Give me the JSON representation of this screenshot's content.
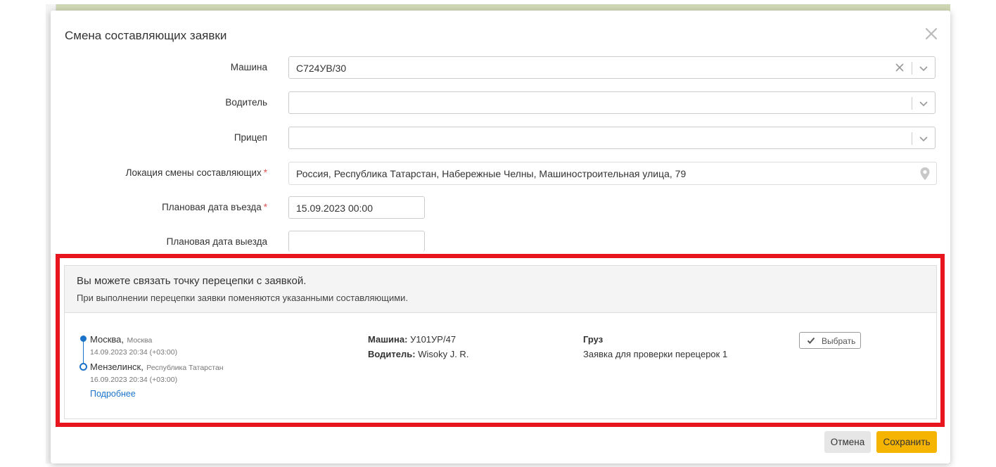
{
  "modal": {
    "title": "Смена составляющих заявки"
  },
  "form": {
    "vehicle_label": "Машина",
    "vehicle_value": "С724УВ/30",
    "driver_label": "Водитель",
    "driver_value": "",
    "trailer_label": "Прицеп",
    "trailer_value": "",
    "location_label": "Локация смены составляющих",
    "location_value": "Россия, Республика Татарстан, Набережные Челны, Машиностроительная улица, 79",
    "entry_date_label": "Плановая дата въезда",
    "entry_date_value": "15.09.2023 00:00",
    "exit_date_label": "Плановая дата выезда",
    "exit_date_value": "",
    "required_mark": "*"
  },
  "transfer_panel": {
    "title": "Вы можете связать точку перецепки с заявкой.",
    "subtitle": "При выполнении перецепки заявки поменяются указанными составляющими.",
    "route": {
      "from_city": "Москва",
      "from_region": "Москва",
      "from_date": "14.09.2023 20:34 (+03:00)",
      "to_city": "Мензелинск",
      "to_region": "Республика Татарстан",
      "to_date": "16.09.2023 20:34 (+03:00)",
      "more_link": "Подробнее"
    },
    "vehicle_label": "Машина:",
    "vehicle_value": "У101УР/47",
    "driver_label": "Водитель:",
    "driver_value": "Wisoky J. R.",
    "cargo_label": "Груз",
    "cargo_value": "Заявка для проверки перецерок 1",
    "choose_button": "Выбрать"
  },
  "footer": {
    "cancel": "Отмена",
    "save": "Сохранить"
  },
  "colors": {
    "accent": "#1a73c8",
    "highlight": "#e8141e",
    "save_button": "#f5b302"
  }
}
